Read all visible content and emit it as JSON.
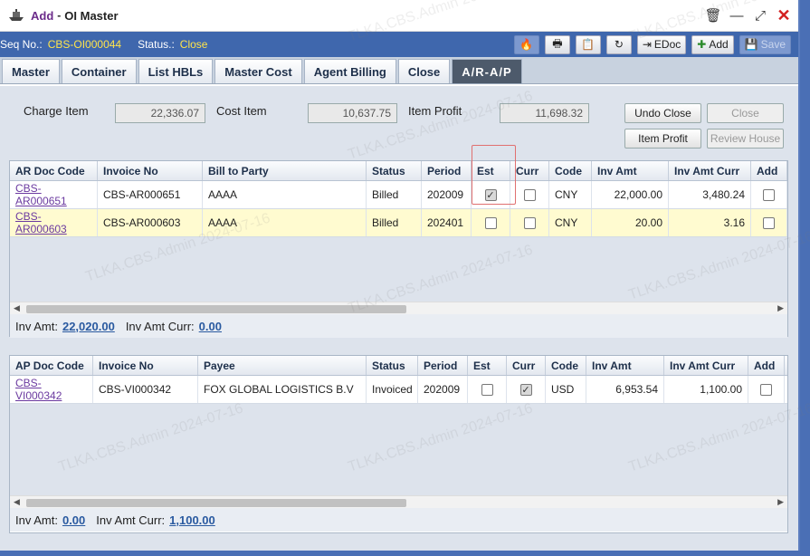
{
  "window": {
    "title": "Add",
    "subtitle": "OI Master"
  },
  "seqbar": {
    "seq_label": "Seq No.:",
    "seq_value": "CBS-OI000044",
    "status_label": "Status.:",
    "status_value": "Close",
    "edoc_label": "EDoc",
    "add_label": "Add",
    "save_label": "Save"
  },
  "tabs": [
    "Master",
    "Container",
    "List HBLs",
    "Master Cost",
    "Agent Billing",
    "Close",
    "A/R-A/P"
  ],
  "summary": {
    "charge_item_label": "Charge Item",
    "charge_item_value": "22,336.07",
    "cost_item_label": "Cost Item",
    "cost_item_value": "10,637.75",
    "item_profit_label": "Item Profit",
    "item_profit_value": "11,698.32",
    "undo_close_label": "Undo Close",
    "close_label": "Close",
    "item_profit_btn_label": "Item Profit",
    "review_house_label": "Review House"
  },
  "ar_grid": {
    "columns": [
      "AR Doc Code",
      "Invoice No",
      "Bill to Party",
      "Status",
      "Period",
      "Est",
      "Curr",
      "Code",
      "Inv Amt",
      "Inv Amt Curr",
      "Add"
    ],
    "rows": [
      {
        "doc": "CBS-AR000651",
        "invoice": "CBS-AR000651",
        "party": "AAAA",
        "status": "Billed",
        "period": "202009",
        "est": true,
        "curr": false,
        "code": "CNY",
        "amt": "22,000.00",
        "amt_curr": "3,480.24",
        "add": false
      },
      {
        "doc": "CBS-AR000603",
        "invoice": "CBS-AR000603",
        "party": "AAAA",
        "status": "Billed",
        "period": "202401",
        "est": false,
        "curr": false,
        "code": "CNY",
        "amt": "20.00",
        "amt_curr": "3.16",
        "add": false
      }
    ],
    "footer": {
      "inv_amt_label": "Inv Amt:",
      "inv_amt_value": "22,020.00",
      "inv_amt_curr_label": "Inv Amt Curr:",
      "inv_amt_curr_value": "0.00"
    }
  },
  "ap_grid": {
    "columns": [
      "AP Doc Code",
      "Invoice No",
      "Payee",
      "Status",
      "Period",
      "Est",
      "Curr",
      "Code",
      "Inv Amt",
      "Inv Amt Curr",
      "Add"
    ],
    "rows": [
      {
        "doc": "CBS-VI000342",
        "invoice": "CBS-VI000342",
        "party": "FOX GLOBAL LOGISTICS B.V",
        "status": "Invoiced",
        "period": "202009",
        "est": false,
        "curr": true,
        "code": "USD",
        "amt": "6,953.54",
        "amt_curr": "1,100.00",
        "add": false
      }
    ],
    "footer": {
      "inv_amt_label": "Inv Amt:",
      "inv_amt_value": "0.00",
      "inv_amt_curr_label": "Inv Amt Curr:",
      "inv_amt_curr_value": "1,100.00"
    }
  },
  "watermark": "TLKA.CBS.Admin 2024-07-16",
  "colors": {
    "accent": "#3f67ad",
    "status_yellow": "#ffe44a",
    "link": "#6b3aa0",
    "footer_amount": "#2a5aa0"
  }
}
